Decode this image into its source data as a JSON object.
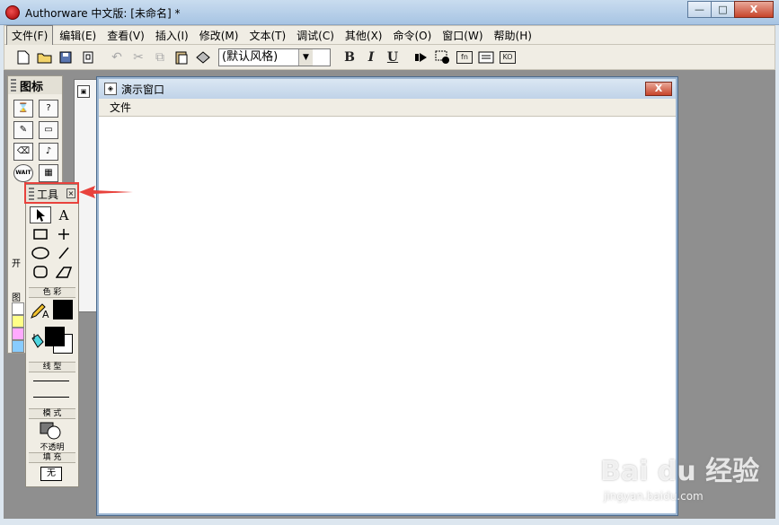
{
  "app": {
    "title": "Authorware 中文版: [未命名] *"
  },
  "window_controls": {
    "minimize": "—",
    "maximize": "□",
    "close": "X"
  },
  "menu": {
    "items": [
      "文件(F)",
      "编辑(E)",
      "查看(V)",
      "插入(I)",
      "修改(M)",
      "文本(T)",
      "调试(C)",
      "其他(X)",
      "命令(O)",
      "窗口(W)",
      "帮助(H)"
    ]
  },
  "toolbar": {
    "style_value": "(默认风格)",
    "bold": "B",
    "italic": "I",
    "underline": "U",
    "fn_label": "fn",
    "ko_label": "KO"
  },
  "icon_palette": {
    "title": "图标",
    "labels": {
      "start": "开",
      "color": "图"
    },
    "swatch_colors": [
      "#ffffff",
      "#ffff88",
      "#ffaaff",
      "#88ccff"
    ]
  },
  "presentation": {
    "title": "演示窗口",
    "menu_file": "文件",
    "close": "X"
  },
  "tools": {
    "title": "工具",
    "section_color": "色 彩",
    "section_line": "线 型",
    "section_mode": "模 式",
    "mode_value": "不透明",
    "section_fill": "填 充",
    "fill_value": "无",
    "text_tool": "A",
    "pencil_letter": "A"
  },
  "colors": {
    "highlight": "#e8423c",
    "title_bar": "#b5cde7",
    "workspace": "#8f8f8f"
  },
  "watermark": {
    "logo": "Bai du 经验",
    "url": "jingyan.baidu.com"
  }
}
